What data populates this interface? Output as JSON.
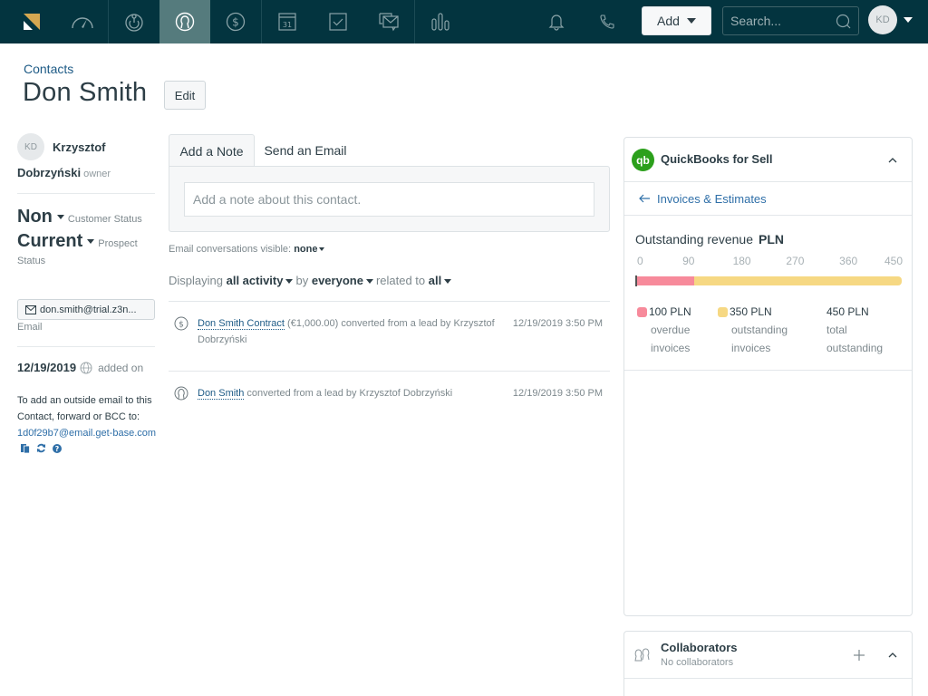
{
  "nav": {
    "items": [
      {
        "name": "logo",
        "icon": "base-logo-icon"
      },
      {
        "name": "dashboard",
        "icon": "speedometer-icon"
      },
      {
        "name": "leads",
        "icon": "lead-target-icon"
      },
      {
        "name": "contacts",
        "icon": "contact-person-icon",
        "active": true
      },
      {
        "name": "deals",
        "icon": "dollar-circle-icon"
      },
      {
        "name": "calendar",
        "icon": "calendar-icon",
        "calendar_day": "31"
      },
      {
        "name": "tasks",
        "icon": "checkbox-icon"
      },
      {
        "name": "communication",
        "icon": "messages-icon"
      },
      {
        "name": "reports",
        "icon": "bar-chart-icon"
      }
    ],
    "notifications_icon": "bell-icon",
    "phone_icon": "phone-icon",
    "add_label": "Add",
    "search_placeholder": "Search...",
    "user_initials": "KD"
  },
  "header": {
    "breadcrumb": "Contacts",
    "title": "Don Smith",
    "edit_label": "Edit"
  },
  "sidebar": {
    "owner_initials": "KD",
    "owner_first": "Krzysztof",
    "owner_last": "Dobrzyński",
    "owner_role": "owner",
    "customer_status_value": "Non",
    "customer_status_label": "Customer Status",
    "prospect_status_value": "Current",
    "prospect_status_label": "Prospect",
    "prospect_status_label2": "Status",
    "email_value": "don.smith@trial.z3n...",
    "email_label": "Email",
    "added_date": "12/19/2019",
    "added_label": "added on",
    "bcc_text": "To add an outside email to this Contact, forward or BCC to: ",
    "bcc_email": "1d0f29b7@email.get-base.com"
  },
  "composer": {
    "tabs": [
      "Add a Note",
      "Send an Email"
    ],
    "active_tab": "Add a Note",
    "note_placeholder": "Add a note about this contact."
  },
  "filters": {
    "email_visible_label": "Email conversations visible:",
    "email_visible_value": "none",
    "displaying_label": "Displaying",
    "activity_value": "all activity",
    "by_label": "by",
    "by_value": "everyone",
    "related_label": "related to",
    "related_value": "all"
  },
  "activities": [
    {
      "icon": "dollar-circle-icon",
      "link": "Don Smith Contract",
      "text": " (€1,000.00) converted from a lead by Krzysztof Dobrzyński",
      "time": "12/19/2019 3:50 PM"
    },
    {
      "icon": "contact-person-icon",
      "link": "Don Smith",
      "text": " converted from a lead by Krzysztof Dobrzyński",
      "time": "12/19/2019 3:50 PM"
    }
  ],
  "quickbooks": {
    "title": "QuickBooks for Sell",
    "logo_text": "qb",
    "back_link": "Invoices & Estimates",
    "revenue_title": "Outstanding revenue",
    "currency": "PLN",
    "axis_ticks": [
      "0",
      "90",
      "180",
      "270",
      "360",
      "450"
    ],
    "axis_max": 450,
    "overdue_amount": 100,
    "outstanding_amount": 350,
    "colors": {
      "overdue": "#f78a9b",
      "outstanding": "#f6d883"
    },
    "legend": [
      {
        "value": "100 PLN",
        "desc1": "overdue",
        "desc2": "invoices"
      },
      {
        "value": "350 PLN",
        "desc1": "outstanding",
        "desc2": "invoices"
      },
      {
        "value": "450 PLN",
        "desc1": "total",
        "desc2": "outstanding"
      }
    ]
  },
  "collaborators": {
    "title": "Collaborators",
    "subtitle": "No collaborators"
  }
}
